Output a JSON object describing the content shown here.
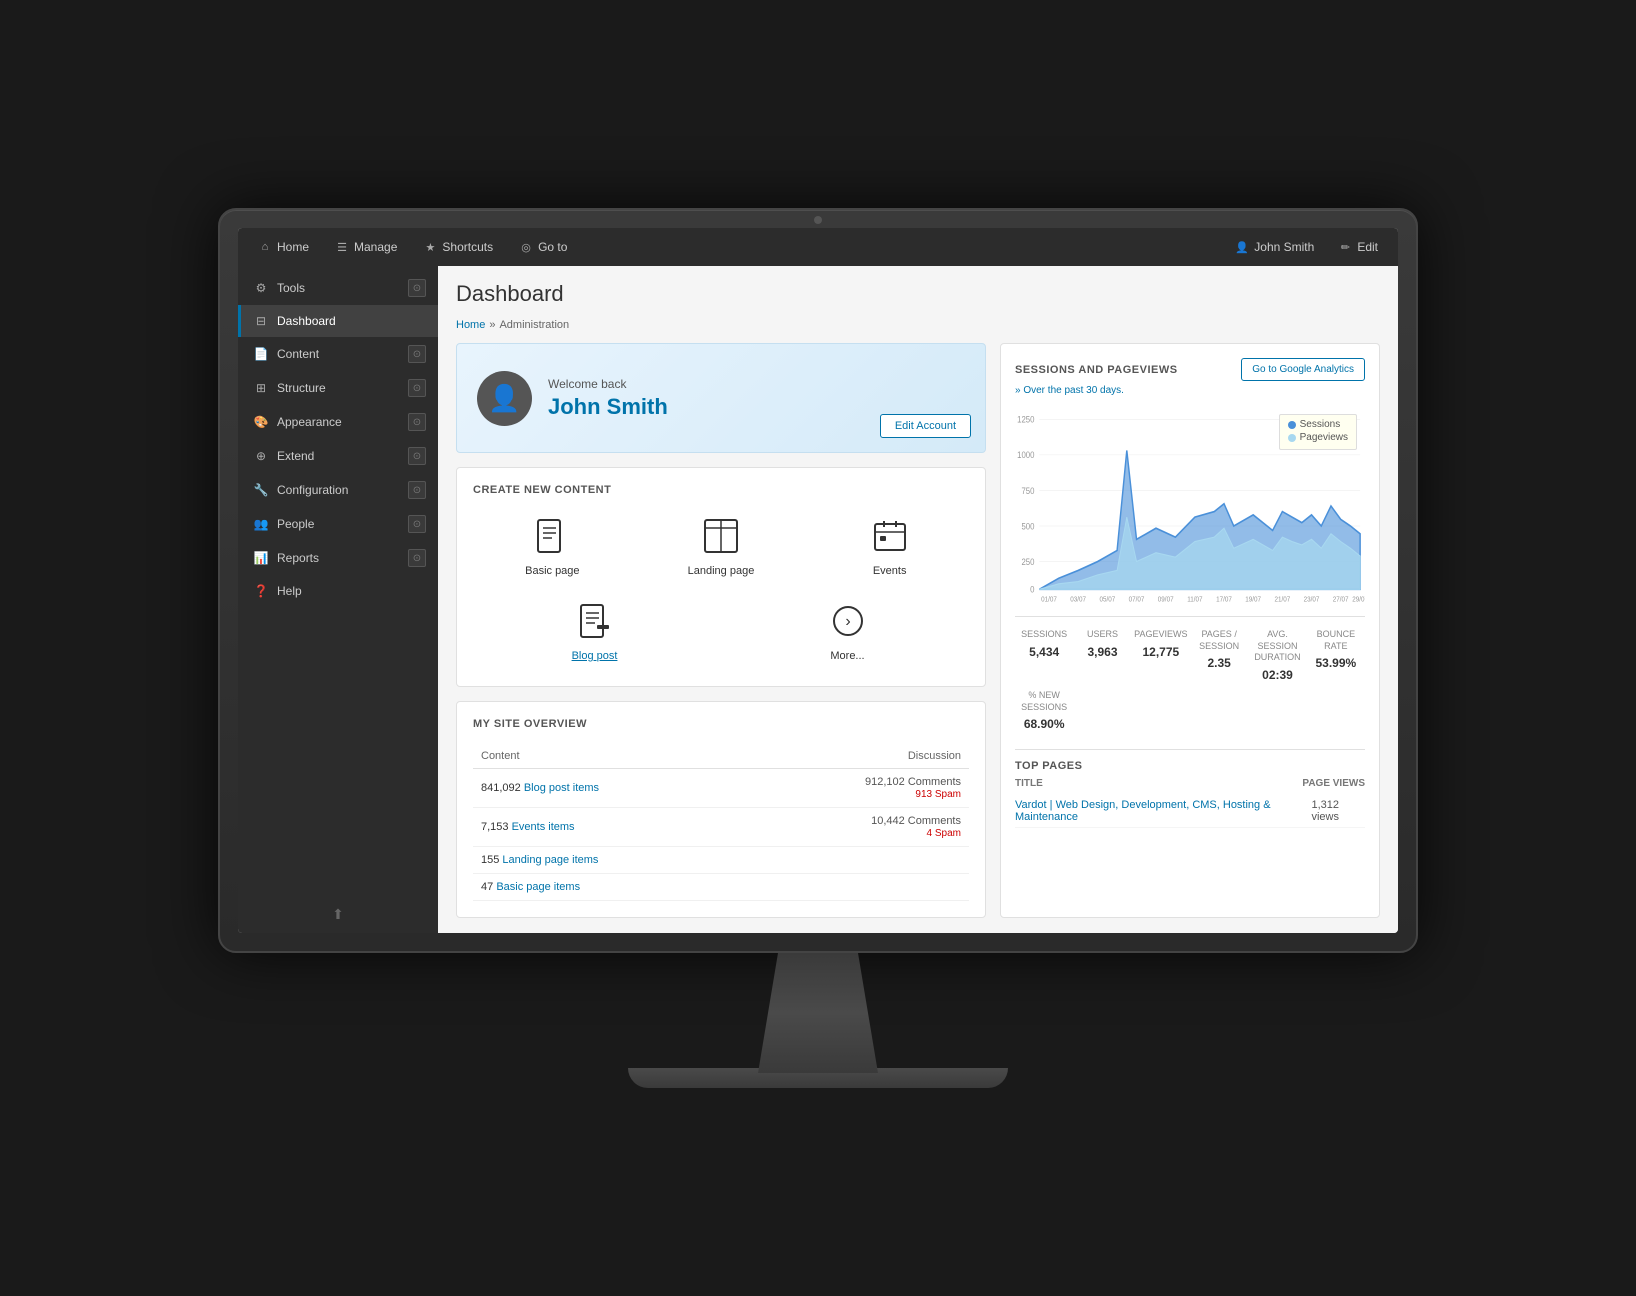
{
  "monitor": {
    "camera_alt": "camera"
  },
  "topnav": {
    "home_label": "Home",
    "manage_label": "Manage",
    "shortcuts_label": "Shortcuts",
    "goto_label": "Go to",
    "user_label": "John Smith",
    "edit_label": "Edit"
  },
  "sidebar": {
    "items": [
      {
        "id": "tools",
        "label": "Tools",
        "has_chevron": true
      },
      {
        "id": "dashboard",
        "label": "Dashboard",
        "has_chevron": false,
        "active": true
      },
      {
        "id": "content",
        "label": "Content",
        "has_chevron": true
      },
      {
        "id": "structure",
        "label": "Structure",
        "has_chevron": true
      },
      {
        "id": "appearance",
        "label": "Appearance",
        "has_chevron": true
      },
      {
        "id": "extend",
        "label": "Extend",
        "has_chevron": true
      },
      {
        "id": "configuration",
        "label": "Configuration",
        "has_chevron": true
      },
      {
        "id": "people",
        "label": "People",
        "has_chevron": true
      },
      {
        "id": "reports",
        "label": "Reports",
        "has_chevron": true
      },
      {
        "id": "help",
        "label": "Help",
        "has_chevron": false
      }
    ]
  },
  "breadcrumb": {
    "home_label": "Home",
    "sep": "»",
    "current": "Administration"
  },
  "page": {
    "title": "Dashboard"
  },
  "welcome": {
    "back_label": "Welcome back",
    "user_name": "John Smith",
    "edit_btn": "Edit Account"
  },
  "create_content": {
    "section_title": "CREATE NEW CONTENT",
    "items": [
      {
        "id": "basic-page",
        "label": "Basic page",
        "icon": "📄"
      },
      {
        "id": "landing-page",
        "label": "Landing page",
        "icon": "⊞"
      },
      {
        "id": "events",
        "label": "Events",
        "icon": "📅"
      },
      {
        "id": "blog-post",
        "label": "Blog post",
        "icon": "📝",
        "is_link": true
      },
      {
        "id": "more",
        "label": "More...",
        "icon": "⊙"
      }
    ]
  },
  "site_overview": {
    "section_title": "MY SITE OVERVIEW",
    "col_content": "Content",
    "col_discussion": "Discussion",
    "rows": [
      {
        "count": "841,092",
        "label": "Blog post items",
        "comments_count": "912,102",
        "comments_label": "Comments",
        "spam_count": "913",
        "spam_label": "Spam"
      },
      {
        "count": "7,153",
        "label": "Events items",
        "comments_count": "10,442",
        "comments_label": "Comments",
        "spam_count": "4",
        "spam_label": "Spam"
      },
      {
        "count": "155",
        "label": "Landing page items",
        "comments_count": "",
        "comments_label": "",
        "spam_count": "",
        "spam_label": ""
      },
      {
        "count": "47",
        "label": "Basic page items",
        "comments_count": "",
        "comments_label": "",
        "spam_count": "",
        "spam_label": ""
      }
    ]
  },
  "analytics": {
    "section_title": "SESSIONS AND PAGEVIEWS",
    "subtitle": "» Over the past 30 days.",
    "go_btn": "Go to Google Analytics",
    "legend": {
      "sessions_label": "Sessions",
      "sessions_color": "#4a90d9",
      "pageviews_label": "Pageviews",
      "pageviews_color": "#a8d8f0"
    },
    "stats": [
      {
        "header": "Sessions",
        "value": "5,434"
      },
      {
        "header": "Users",
        "value": "3,963"
      },
      {
        "header": "Pageviews",
        "value": "12,775"
      },
      {
        "header": "Pages / Session",
        "value": "2.35"
      },
      {
        "header": "Avg. Session Duration",
        "value": "02:39"
      },
      {
        "header": "Bounce Rate",
        "value": "53.99%"
      },
      {
        "header": "% New Sessions",
        "value": "68.90%"
      }
    ],
    "top_pages": {
      "title": "TOP PAGES",
      "col_title": "Title",
      "col_views": "Page views",
      "rows": [
        {
          "title": "Vardot | Web Design, Development, CMS, Hosting & Maintenance",
          "views": "1,312 views"
        }
      ]
    }
  }
}
